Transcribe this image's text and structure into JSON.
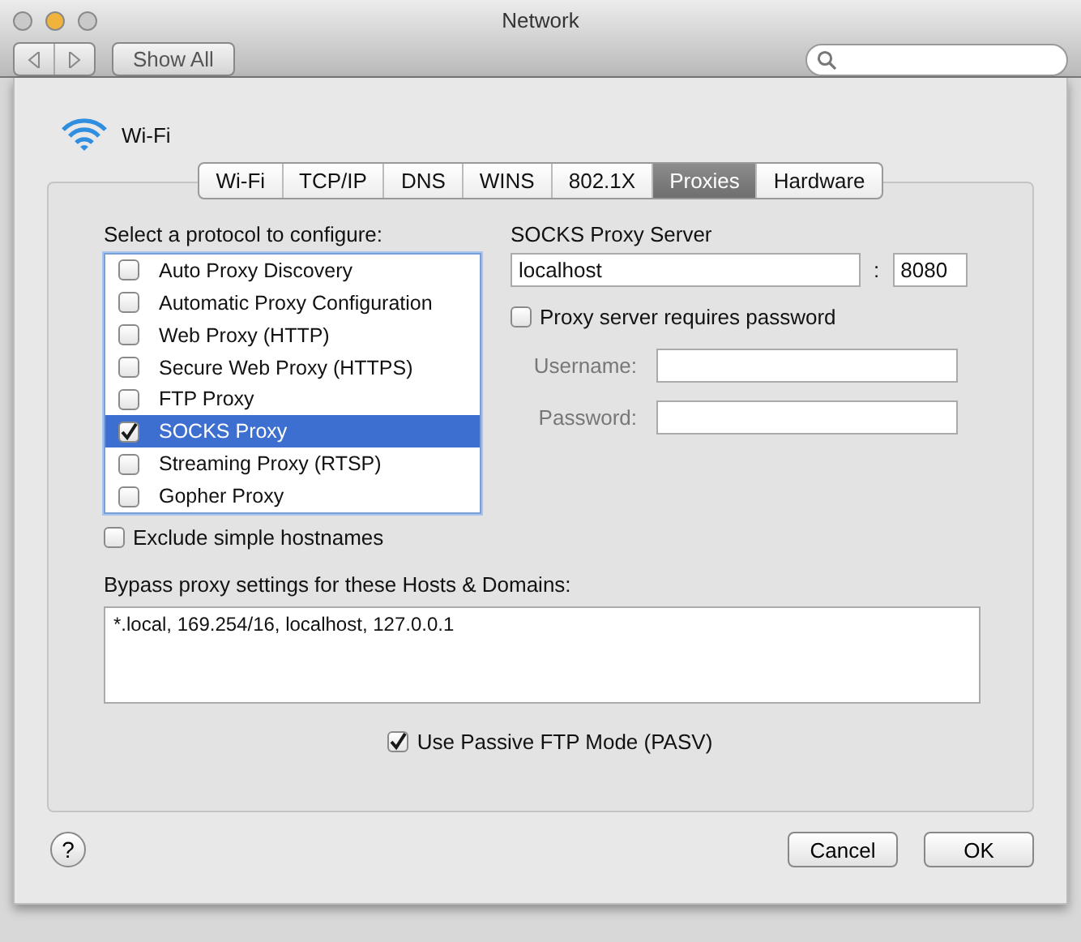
{
  "window": {
    "title": "Network"
  },
  "toolbar": {
    "show_all": "Show All"
  },
  "sheet": {
    "service": "Wi-Fi",
    "tabs": [
      {
        "label": "Wi-Fi",
        "selected": false
      },
      {
        "label": "TCP/IP",
        "selected": false
      },
      {
        "label": "DNS",
        "selected": false
      },
      {
        "label": "WINS",
        "selected": false
      },
      {
        "label": "802.1X",
        "selected": false
      },
      {
        "label": "Proxies",
        "selected": true
      },
      {
        "label": "Hardware",
        "selected": false
      }
    ],
    "protocol_label": "Select a protocol to configure:",
    "protocols": [
      {
        "label": "Auto Proxy Discovery",
        "checked": false,
        "selected": false
      },
      {
        "label": "Automatic Proxy Configuration",
        "checked": false,
        "selected": false
      },
      {
        "label": "Web Proxy (HTTP)",
        "checked": false,
        "selected": false
      },
      {
        "label": "Secure Web Proxy (HTTPS)",
        "checked": false,
        "selected": false
      },
      {
        "label": "FTP Proxy",
        "checked": false,
        "selected": false
      },
      {
        "label": "SOCKS Proxy",
        "checked": true,
        "selected": true
      },
      {
        "label": "Streaming Proxy (RTSP)",
        "checked": false,
        "selected": false
      },
      {
        "label": "Gopher Proxy",
        "checked": false,
        "selected": false
      }
    ],
    "exclude_simple": {
      "label": "Exclude simple hostnames",
      "checked": false
    },
    "server": {
      "title": "SOCKS Proxy Server",
      "host": "localhost",
      "separator": ":",
      "port": "8080"
    },
    "requires_password": {
      "label": "Proxy server requires password",
      "checked": false
    },
    "credentials": [
      {
        "label": "Username:",
        "disabled": true
      },
      {
        "label": "Password:",
        "disabled": true
      }
    ],
    "bypass": {
      "label": "Bypass proxy settings for these Hosts & Domains:",
      "value": "*.local, 169.254/16, localhost, 127.0.0.1"
    },
    "passive_ftp": {
      "label": "Use Passive FTP Mode (PASV)",
      "checked": true
    },
    "help": "?",
    "buttons": [
      {
        "label": "Cancel"
      },
      {
        "label": "OK"
      }
    ]
  }
}
